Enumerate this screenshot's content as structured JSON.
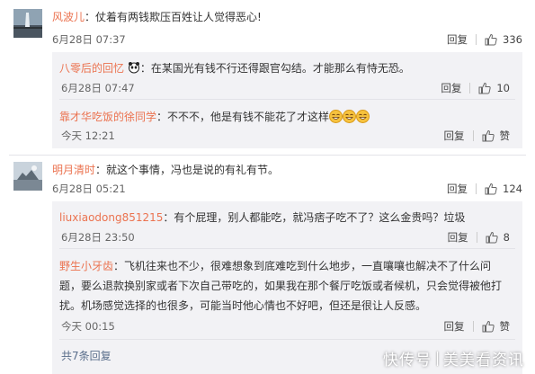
{
  "comments": [
    {
      "user": "风波儿",
      "text": "仗着有两钱欺压百姓让人觉得恶心!",
      "time": "6月28日 07:37",
      "reply_label": "回复",
      "likes": "336",
      "replies": [
        {
          "user": "八零后的回忆",
          "badge": "🐼",
          "text": "在某国光有钱不行还得跟官勾结。才能那么有恃无恐。",
          "time": "6月28日 07:47",
          "reply_label": "回复",
          "likes": "10"
        },
        {
          "user": "靠才华吃饭的徐同学",
          "text": "不不不，他是有钱不能花了才这样",
          "emoji_count": 3,
          "time": "今天 12:21",
          "reply_label": "回复",
          "likes": "赞"
        }
      ]
    },
    {
      "user": "明月清时",
      "text": "就这个事情，冯也是说的有礼有节。",
      "time": "6月28日 05:21",
      "reply_label": "回复",
      "likes": "124",
      "replies": [
        {
          "user": "liuxiaodong851215",
          "text": "有个屁理，别人都能吃，就冯痞子吃不了？这么金贵吗？垃圾",
          "time": "6月28日 23:50",
          "reply_label": "回复",
          "likes": "8"
        },
        {
          "user": "野生小牙齿",
          "text_lines": [
            "飞机往来也不少，很难想象到底难吃到什么地步，一直嚷嚷也解决不了什么问",
            "题，要么退款换别家或者下次自己带吃的，如果我在那个餐厅吃饭或者候机，只会觉得被他打",
            "扰。机场感觉选择的也很多，可能当时他心情也不好吧，但还是很让人反感。"
          ],
          "time": "今天 00:15",
          "reply_label": "回复",
          "likes": "赞"
        }
      ],
      "more_replies": "共7条回复"
    }
  ],
  "watermark": {
    "left": "快传号",
    "right": "美美看资讯"
  },
  "colors": {
    "username": "#eb7350",
    "reply_bg": "#f2f2f5",
    "divider": "#e3e3e8"
  }
}
